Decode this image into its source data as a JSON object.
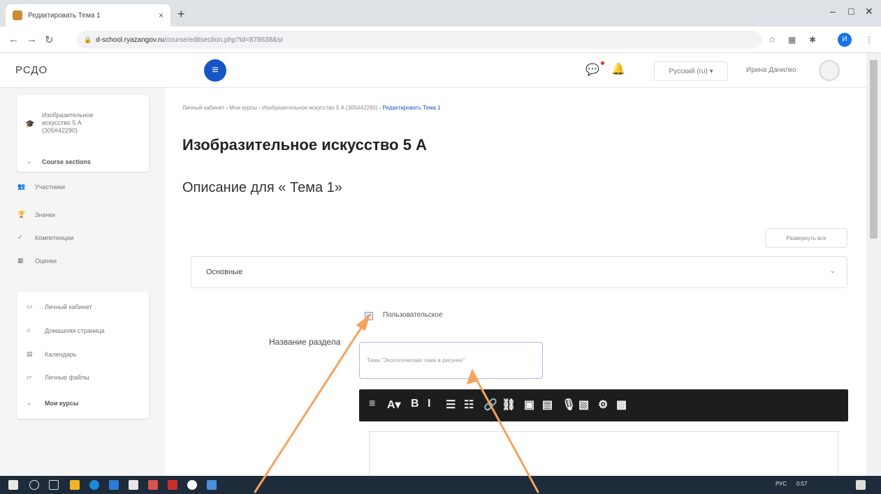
{
  "browser": {
    "tab_title": "Редактировать Тема 1",
    "tab_close": "×",
    "new_tab": "+",
    "url_host": "d-school.ryazangov.ru",
    "url_path": "/course/editsection.php?id=878638&sr",
    "window_controls": [
      "–",
      "□",
      "✕"
    ],
    "profile_letter": "И"
  },
  "header": {
    "brand": "РСДО",
    "language": "Русский (ru) ▾",
    "user_name": "Ирина Данилко"
  },
  "sidebar": {
    "course_card": {
      "course_name": "Изобразительное искусство 5 А (305#42290)",
      "course_sections": "Course sections"
    },
    "items": [
      {
        "icon": "participants-icon",
        "glyph": "👥",
        "label": "Участники"
      },
      {
        "icon": "trophy-icon",
        "glyph": "🏆",
        "label": "Значки"
      },
      {
        "icon": "check-icon",
        "glyph": "✓",
        "label": "Компетенции"
      },
      {
        "icon": "grades-icon",
        "glyph": "▦",
        "label": "Оценки"
      }
    ],
    "nav_items": [
      {
        "icon": "dashboard-icon",
        "glyph": "▭",
        "label": "Личный кабинет"
      },
      {
        "icon": "home-icon",
        "glyph": "⌂",
        "label": "Домашняя страница"
      },
      {
        "icon": "calendar-icon",
        "glyph": "▤",
        "label": "Календарь"
      },
      {
        "icon": "files-icon",
        "glyph": "▱",
        "label": "Личные файлы"
      }
    ],
    "my_courses": "Мои курсы"
  },
  "main": {
    "breadcrumb": [
      "Личный кабинет",
      "Мои курсы",
      "Изобразительное искусство 5 А (305#42290)",
      "Редактировать Тема 1"
    ],
    "title": "Изобразительное искусство 5 А",
    "section_description": "Описание для « Тема 1»",
    "expand_all": "Развернуть все",
    "general_section": "Основные",
    "custom_checkbox_label": "Пользовательское",
    "section_name_label": "Название раздела",
    "section_name_value": "Тема \"Экологическая тема в рисунке\""
  },
  "toolbar": {
    "buttons": [
      {
        "name": "toolbar-toggle-icon",
        "glyph": "≡"
      },
      {
        "name": "font-color-icon",
        "glyph": "A▾"
      },
      {
        "name": "bold-icon",
        "glyph": "B"
      },
      {
        "name": "italic-icon",
        "glyph": "I"
      },
      {
        "name": "unordered-list-icon",
        "glyph": "☰"
      },
      {
        "name": "ordered-list-icon",
        "glyph": "☷"
      },
      {
        "name": "link-icon",
        "glyph": "🔗"
      },
      {
        "name": "unlink-icon",
        "glyph": "⛓"
      },
      {
        "name": "image-icon",
        "glyph": "▣"
      },
      {
        "name": "media-icon",
        "glyph": "▤"
      },
      {
        "name": "record-audio-icon",
        "glyph": "🎙"
      },
      {
        "name": "record-video-icon",
        "glyph": "▧"
      },
      {
        "name": "manage-files-icon",
        "glyph": "⚙"
      },
      {
        "name": "h5p-icon",
        "glyph": "▩"
      }
    ]
  },
  "taskbar": {
    "language": "РУС",
    "time": "0:57"
  },
  "colors": {
    "accent": "#1655c6",
    "arrow": "#f5a35c",
    "toolbar_bg": "#1d1d1d",
    "taskbar_bg": "#1d2b3a"
  }
}
